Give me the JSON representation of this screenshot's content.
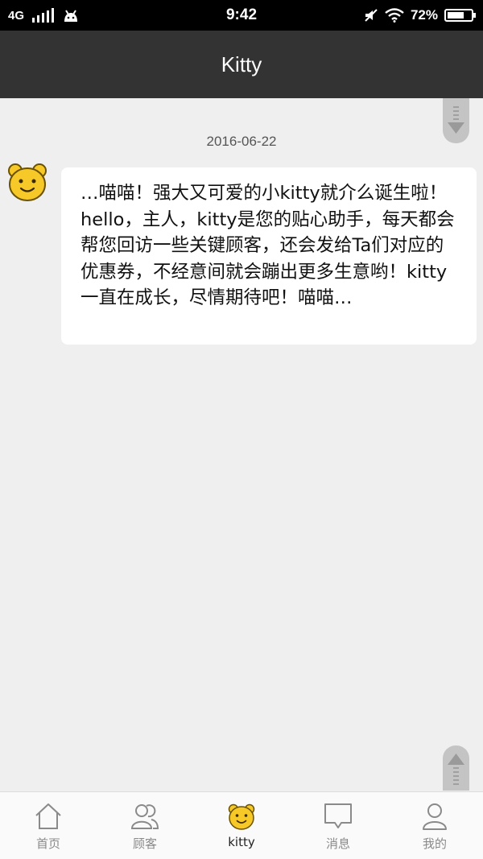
{
  "status_bar": {
    "network": "4G",
    "time": "9:42",
    "battery_percent": "72%",
    "battery_level": 0.72
  },
  "header": {
    "title": "Kitty"
  },
  "chat": {
    "date": "2016-06-22",
    "message": "…喵喵！强大又可爱的小kitty就介么诞生啦！hello，主人，kitty是您的贴心助手，每天都会帮您回访一些关键顾客，还会发给Ta们对应的优惠券，不经意间就会蹦出更多生意哟！kitty一直在成长，尽情期待吧！喵喵…"
  },
  "nav": {
    "items": [
      {
        "label": "首页",
        "icon": "home-icon"
      },
      {
        "label": "顾客",
        "icon": "customers-icon"
      },
      {
        "label": "kitty",
        "icon": "kitty-bear-icon"
      },
      {
        "label": "消息",
        "icon": "message-icon"
      },
      {
        "label": "我的",
        "icon": "profile-icon"
      }
    ],
    "active_index": 2
  },
  "colors": {
    "title_bar": "#333333",
    "background": "#efefef",
    "bear_yellow": "#f7c928"
  }
}
